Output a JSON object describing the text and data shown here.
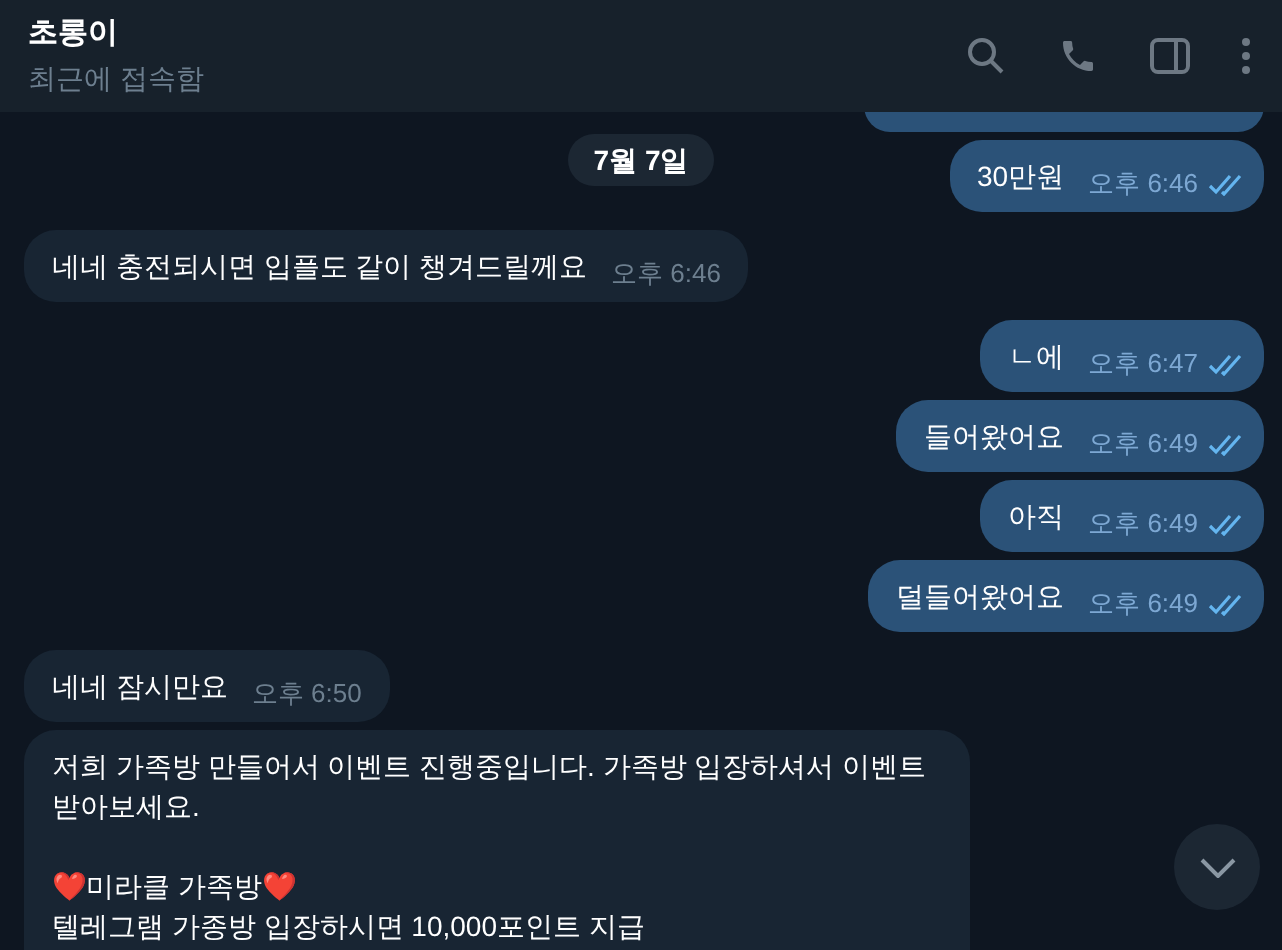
{
  "header": {
    "title": "초롱이",
    "status": "최근에 접속함"
  },
  "date_badge": "7월 7일",
  "messages": [
    {
      "kind": "outgoing"
    },
    {
      "kind": "outgoing",
      "text": "30만원",
      "time": "오후 6:46",
      "read": true
    },
    {
      "kind": "incoming",
      "text": "네네 충전되시면 입플도 같이 챙겨드릴께요",
      "time": "오후 6:46"
    },
    {
      "kind": "outgoing",
      "text": "ㄴ에",
      "time": "오후 6:47",
      "read": true
    },
    {
      "kind": "outgoing",
      "text": "들어왔어요",
      "time": "오후 6:49",
      "read": true
    },
    {
      "kind": "outgoing",
      "text": "아직",
      "time": "오후 6:49",
      "read": true
    },
    {
      "kind": "outgoing",
      "text": "덜들어왔어요",
      "time": "오후 6:49",
      "read": true
    },
    {
      "kind": "incoming",
      "text": "네네 잠시만요",
      "time": "오후 6:50"
    },
    {
      "kind": "incoming",
      "text": "저희 가족방 만들어서 이벤트 진행중입니다. 가족방 입장하셔서 이벤트 받아보세요.\n\n❤️미라클 가족방❤️\n텔레그램 가종방 입장하시면 10,000포인트 지급"
    }
  ]
}
